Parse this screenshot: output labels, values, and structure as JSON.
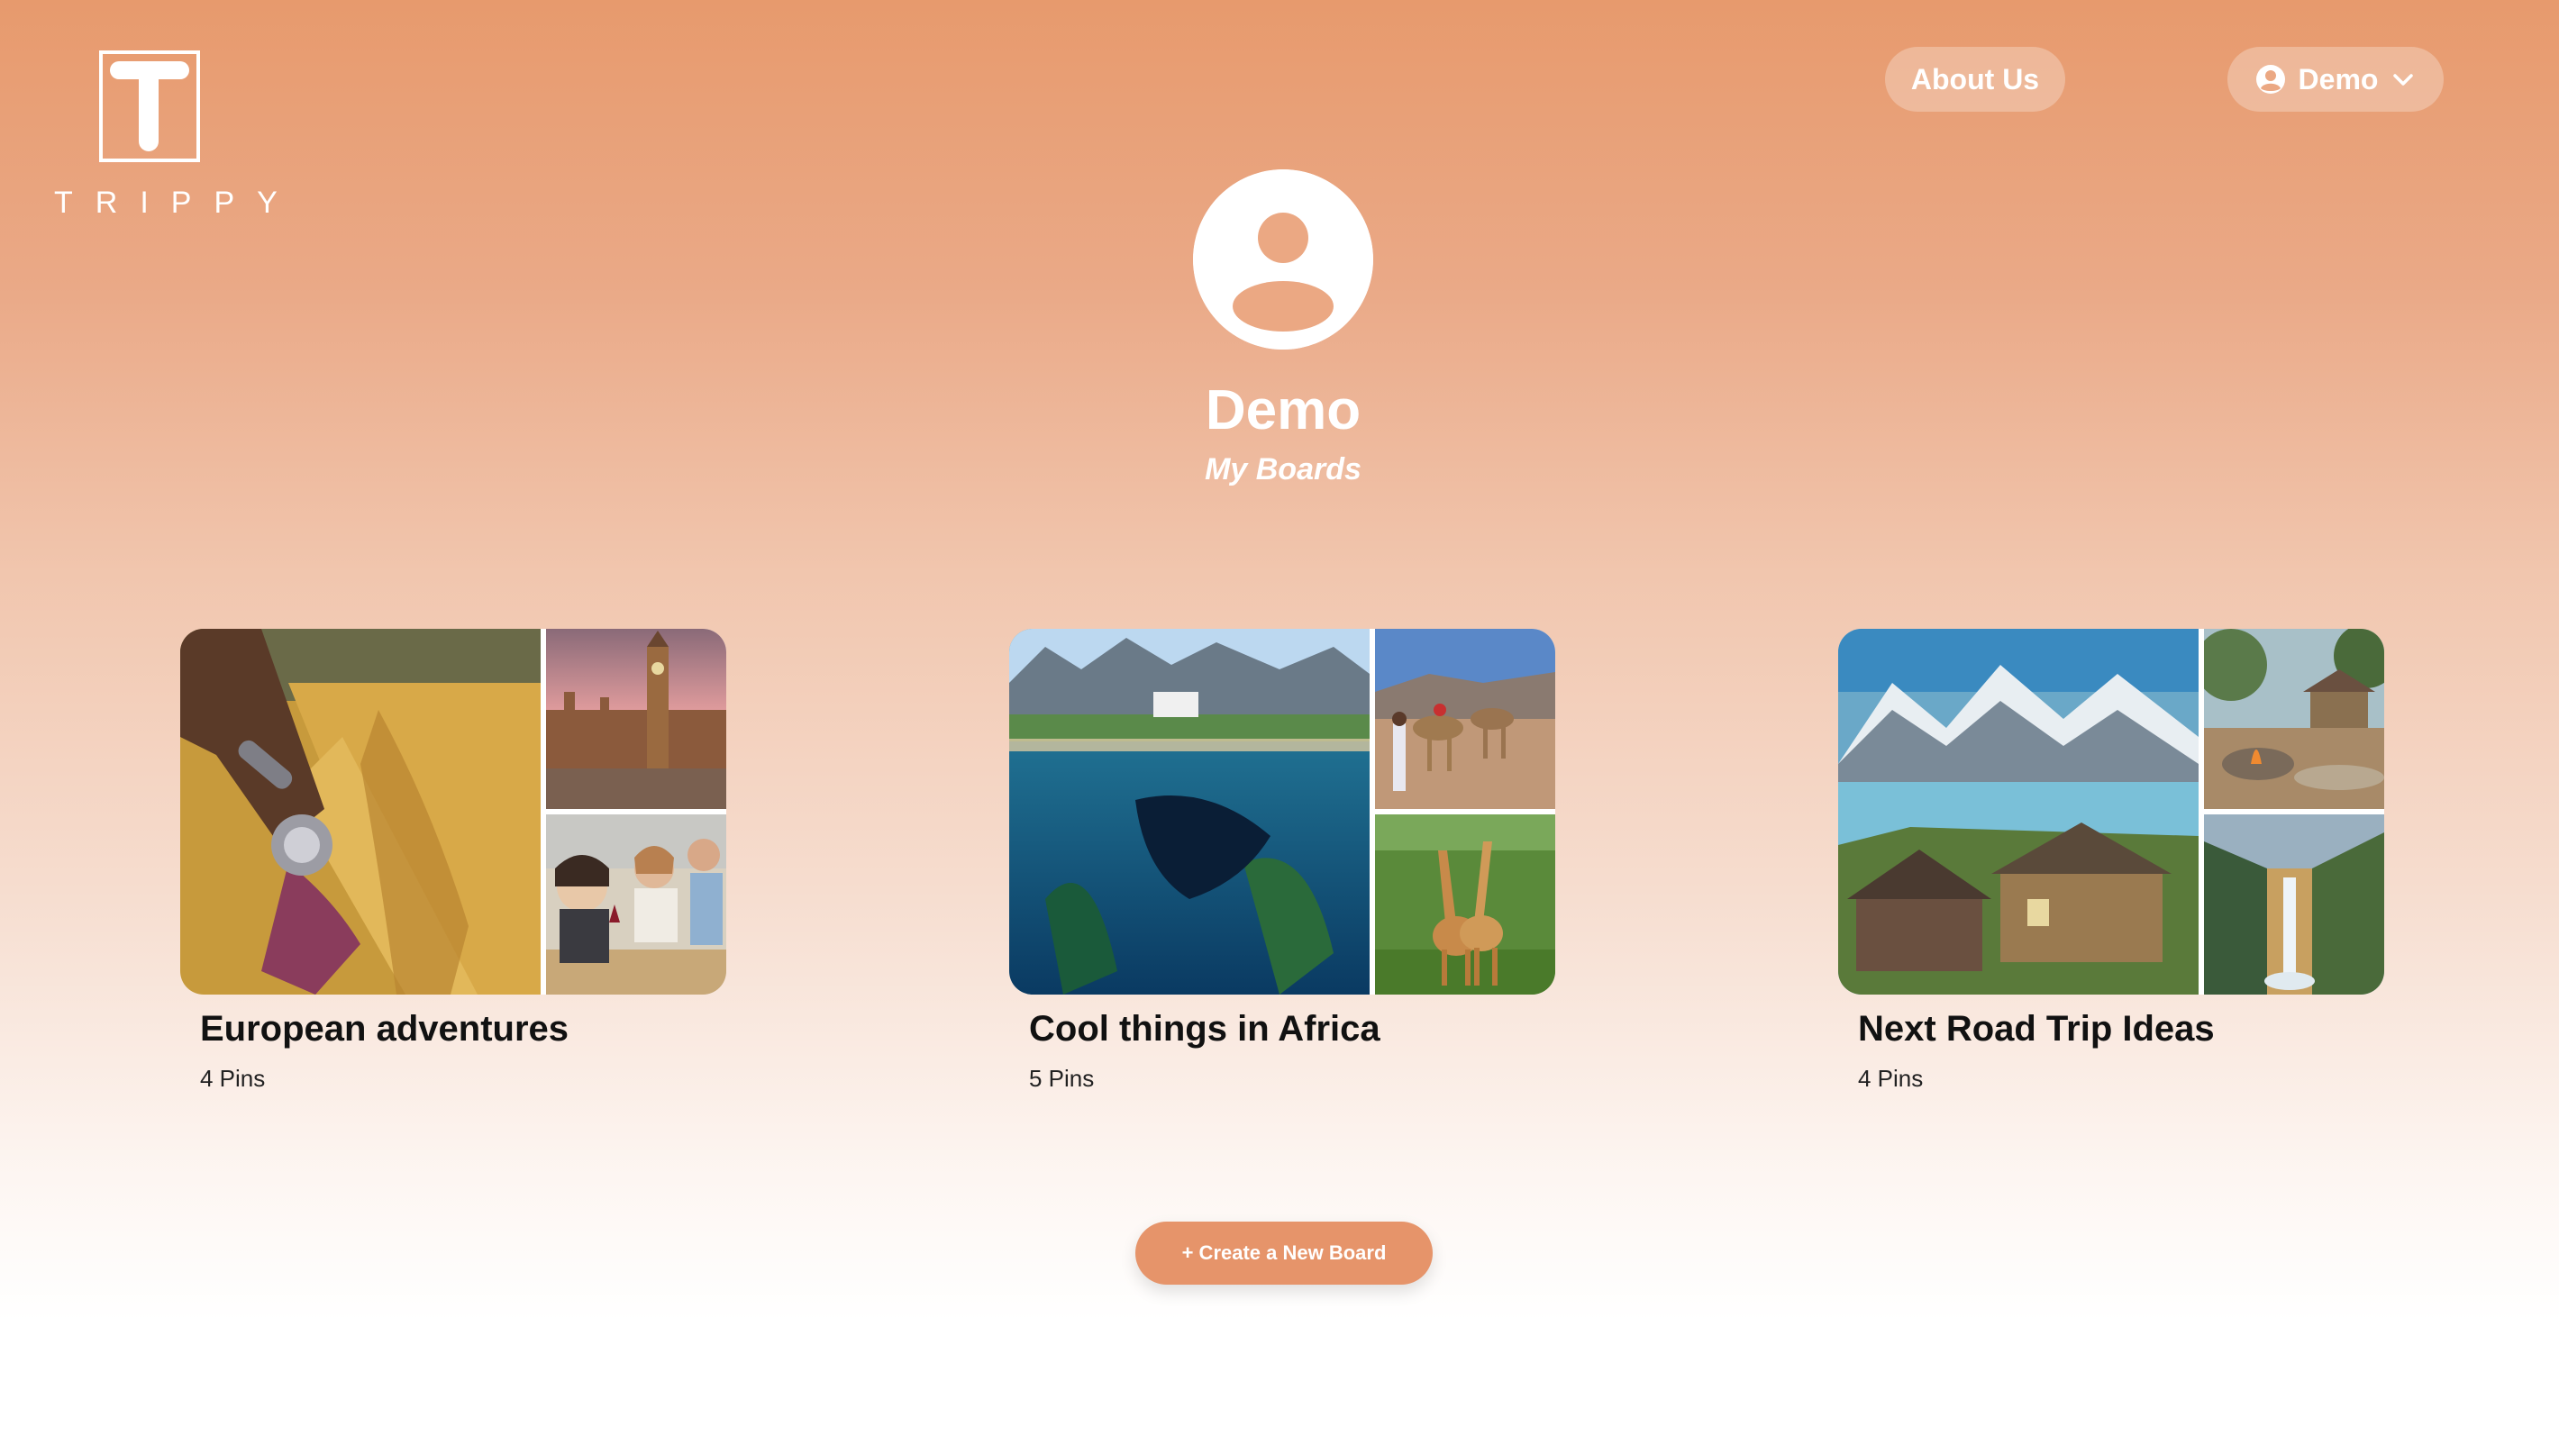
{
  "brand": {
    "wordmark": "TRIPPY",
    "logo_letter": "T",
    "logo_icon": "logo-mark"
  },
  "header": {
    "about_label": "About Us",
    "user_label": "Demo",
    "user_icon": "user-circle-icon",
    "dropdown_icon": "chevron-down-icon"
  },
  "profile": {
    "avatar_icon": "avatar-placeholder-icon",
    "name": "Demo",
    "subtitle": "My Boards"
  },
  "boards": [
    {
      "title": "European adventures",
      "count": "4 Pins"
    },
    {
      "title": "Cool things in Africa",
      "count": "5 Pins"
    },
    {
      "title": "Next Road Trip Ideas",
      "count": "4 Pins"
    }
  ],
  "create_button": {
    "label": "+ Create a New Board"
  },
  "colors": {
    "accent": "#e6946a",
    "gradient_top": "#e79a6d",
    "gradient_bottom": "#ffffff"
  }
}
